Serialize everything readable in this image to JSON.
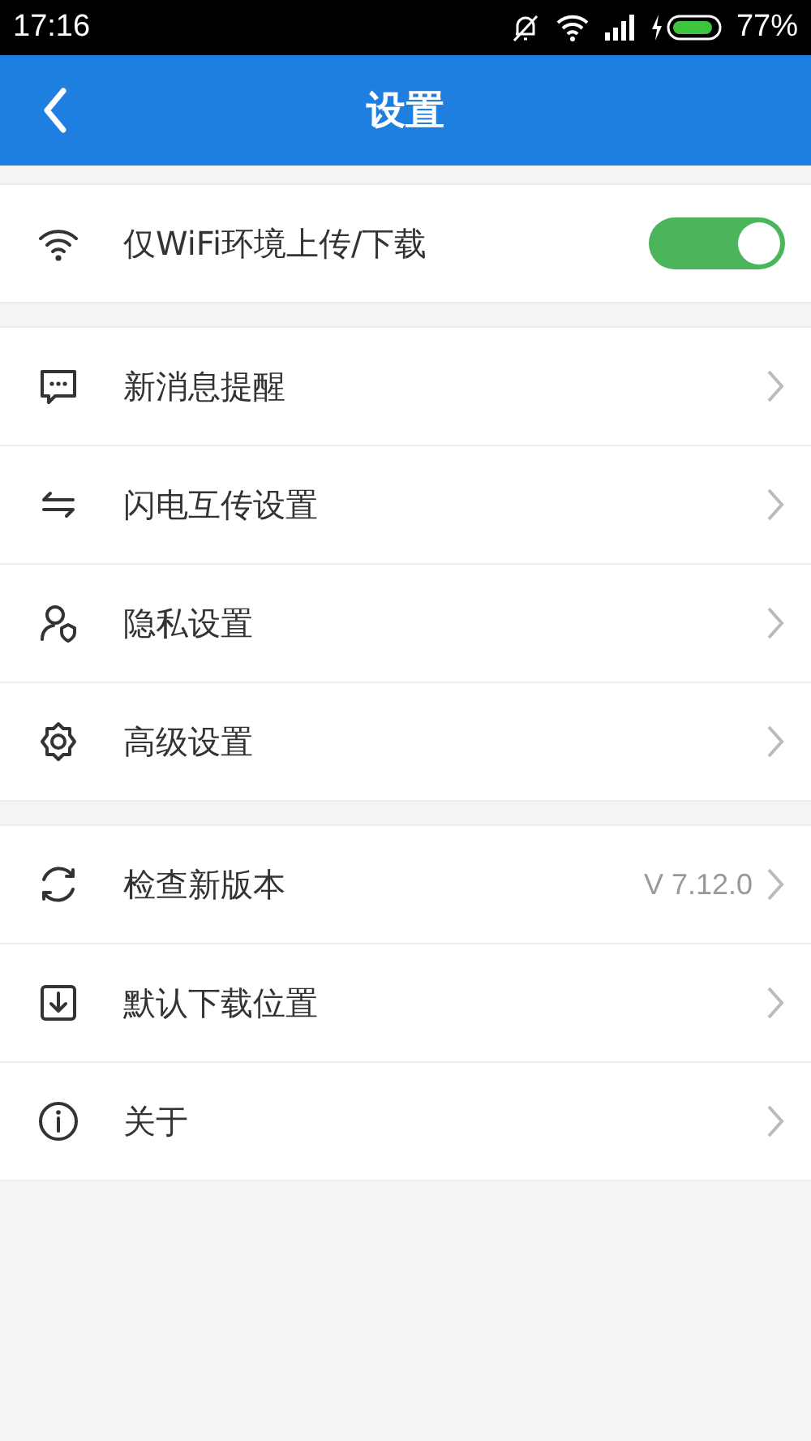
{
  "status_bar": {
    "time": "17:16",
    "battery": "77%"
  },
  "header": {
    "title": "设置"
  },
  "sections": [
    {
      "items": [
        {
          "kind": "toggle",
          "label": "仅WiFi环境上传/下载",
          "on": true
        }
      ]
    },
    {
      "items": [
        {
          "kind": "link",
          "label": "新消息提醒"
        },
        {
          "kind": "link",
          "label": "闪电互传设置"
        },
        {
          "kind": "link",
          "label": "隐私设置"
        },
        {
          "kind": "link",
          "label": "高级设置"
        }
      ]
    },
    {
      "items": [
        {
          "kind": "link",
          "label": "检查新版本",
          "value": "V 7.12.0"
        },
        {
          "kind": "link",
          "label": "默认下载位置"
        },
        {
          "kind": "link",
          "label": "关于"
        }
      ]
    }
  ]
}
